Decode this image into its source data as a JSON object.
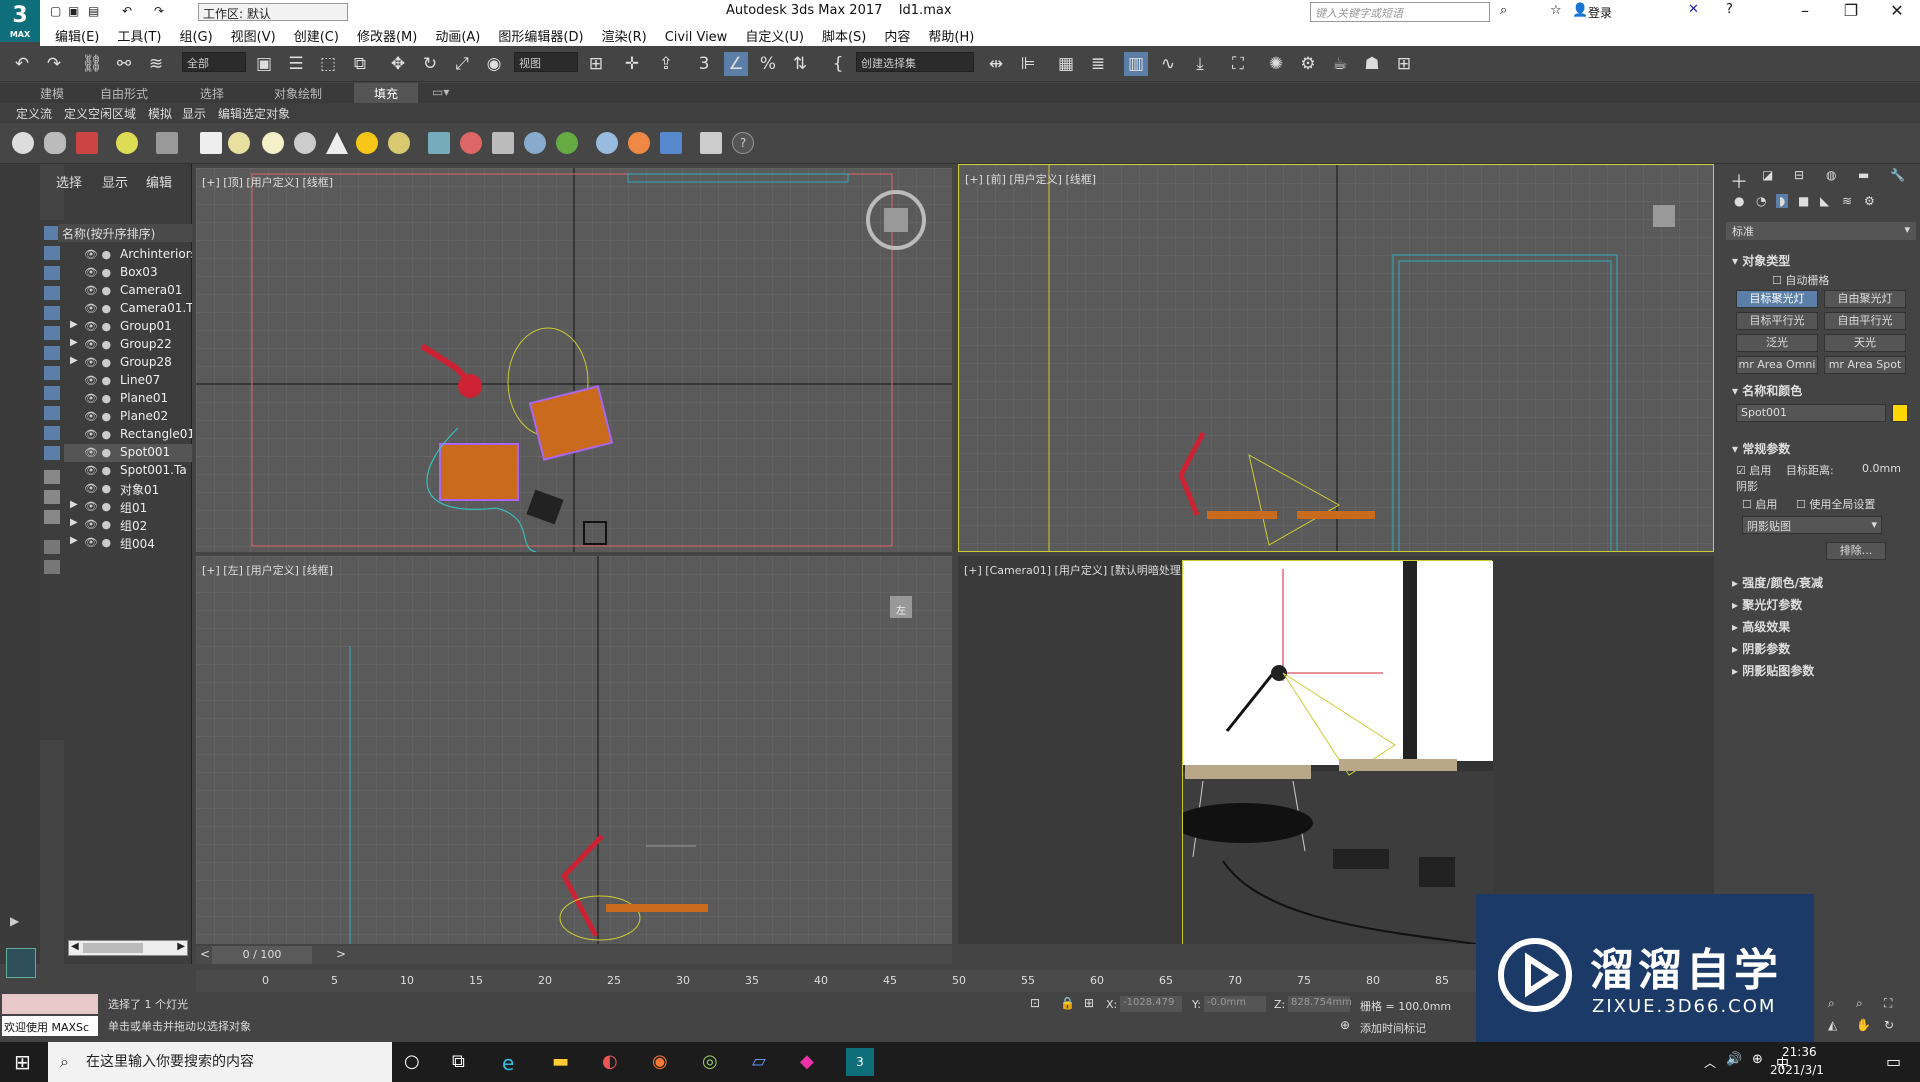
{
  "app": {
    "title": "Autodesk 3ds Max 2017",
    "file": "ld1.max",
    "logo_text": "3",
    "logo_sub": "MAX",
    "workspace_label": "工作区: 默认",
    "search_placeholder": "键入关键字或短语",
    "login": "登录"
  },
  "menu": [
    "编辑(E)",
    "工具(T)",
    "组(G)",
    "视图(V)",
    "创建(C)",
    "修改器(M)",
    "动画(A)",
    "图形编辑器(D)",
    "渲染(R)",
    "Civil View",
    "自定义(U)",
    "脚本(S)",
    "内容",
    "帮助(H)"
  ],
  "toolbar": {
    "filter": "全部",
    "refcoord": "视图",
    "selset": "创建选择集"
  },
  "ribbon": {
    "tabs": [
      "建模",
      "自由形式",
      "选择",
      "对象绘制",
      "填充"
    ],
    "sub": [
      "定义流",
      "定义空闲区域",
      "模拟",
      "显示",
      "编辑选定对象"
    ]
  },
  "scene_explorer": {
    "tabs": [
      "选择",
      "显示",
      "编辑"
    ],
    "header": "名称(按升序排序)",
    "items": [
      {
        "name": "Archinteriors",
        "expand": false,
        "sel": false
      },
      {
        "name": "Box03",
        "expand": false,
        "sel": false
      },
      {
        "name": "Camera01",
        "expand": false,
        "sel": false
      },
      {
        "name": "Camera01.T",
        "expand": false,
        "sel": false
      },
      {
        "name": "Group01",
        "expand": true,
        "sel": false
      },
      {
        "name": "Group22",
        "expand": true,
        "sel": false
      },
      {
        "name": "Group28",
        "expand": true,
        "sel": false
      },
      {
        "name": "Line07",
        "expand": false,
        "sel": false
      },
      {
        "name": "Plane01",
        "expand": false,
        "sel": false
      },
      {
        "name": "Plane02",
        "expand": false,
        "sel": false
      },
      {
        "name": "Rectangle01",
        "expand": false,
        "sel": false
      },
      {
        "name": "Spot001",
        "expand": false,
        "sel": true
      },
      {
        "name": "Spot001.Ta",
        "expand": false,
        "sel": false
      },
      {
        "name": "对象01",
        "expand": false,
        "sel": false
      },
      {
        "name": "组01",
        "expand": true,
        "sel": false
      },
      {
        "name": "组02",
        "expand": true,
        "sel": false
      },
      {
        "name": "组004",
        "expand": true,
        "sel": false
      }
    ]
  },
  "viewports": {
    "top": "[+] [顶] [用户定义] [线框]",
    "front": "[+] [前] [用户定义] [线框]",
    "left": "[+] [左] [用户定义] [线框]",
    "camera": "[+] [Camera01] [用户定义] [默认明暗处理]",
    "cube_top": "",
    "cube_left": "左"
  },
  "command_panel": {
    "category": "标准",
    "obj_type": "对象类型",
    "autogrid": "自动栅格",
    "buttons": [
      "目标聚光灯",
      "自由聚光灯",
      "目标平行光",
      "自由平行光",
      "泛光",
      "天光",
      "mr Area Omni",
      "mr Area Spot"
    ],
    "name_color": "名称和颜色",
    "obj_name": "Spot001",
    "color": "#ffd700",
    "general": "常规参数",
    "enable": "启用",
    "target_dist_label": "目标距离:",
    "target_dist": "0.0mm",
    "shadow": "阴影",
    "shadow_on": "启用",
    "global": "使用全局设置",
    "shadow_map": "阴影贴图",
    "exclude": "排除...",
    "rollouts": [
      "强度/颜色/衰减",
      "聚光灯参数",
      "高级效果",
      "阴影参数",
      "阴影贴图参数"
    ]
  },
  "timeline": {
    "frame": "0 / 100",
    "ticks": [
      "0",
      "5",
      "10",
      "15",
      "20",
      "25",
      "30",
      "35",
      "40",
      "45",
      "50",
      "55",
      "60",
      "65",
      "70",
      "75",
      "80",
      "85"
    ]
  },
  "status": {
    "welcome": "欢迎使用 MAXSc",
    "selected": "选择了 1 个灯光",
    "hint": "单击或单击并拖动以选择对象",
    "x": "-1028.479",
    "y": "-0.0mm",
    "z": "828.754mm",
    "grid": "栅格 = 100.0mm",
    "addtime": "添加时间标记"
  },
  "taskbar": {
    "search": "在这里输入你要搜索的内容",
    "time": "21:36",
    "date": "2021/3/1",
    "ime": "中"
  },
  "watermark": {
    "title": "溜溜自学",
    "url": "ZIXUE.3D66.COM"
  }
}
